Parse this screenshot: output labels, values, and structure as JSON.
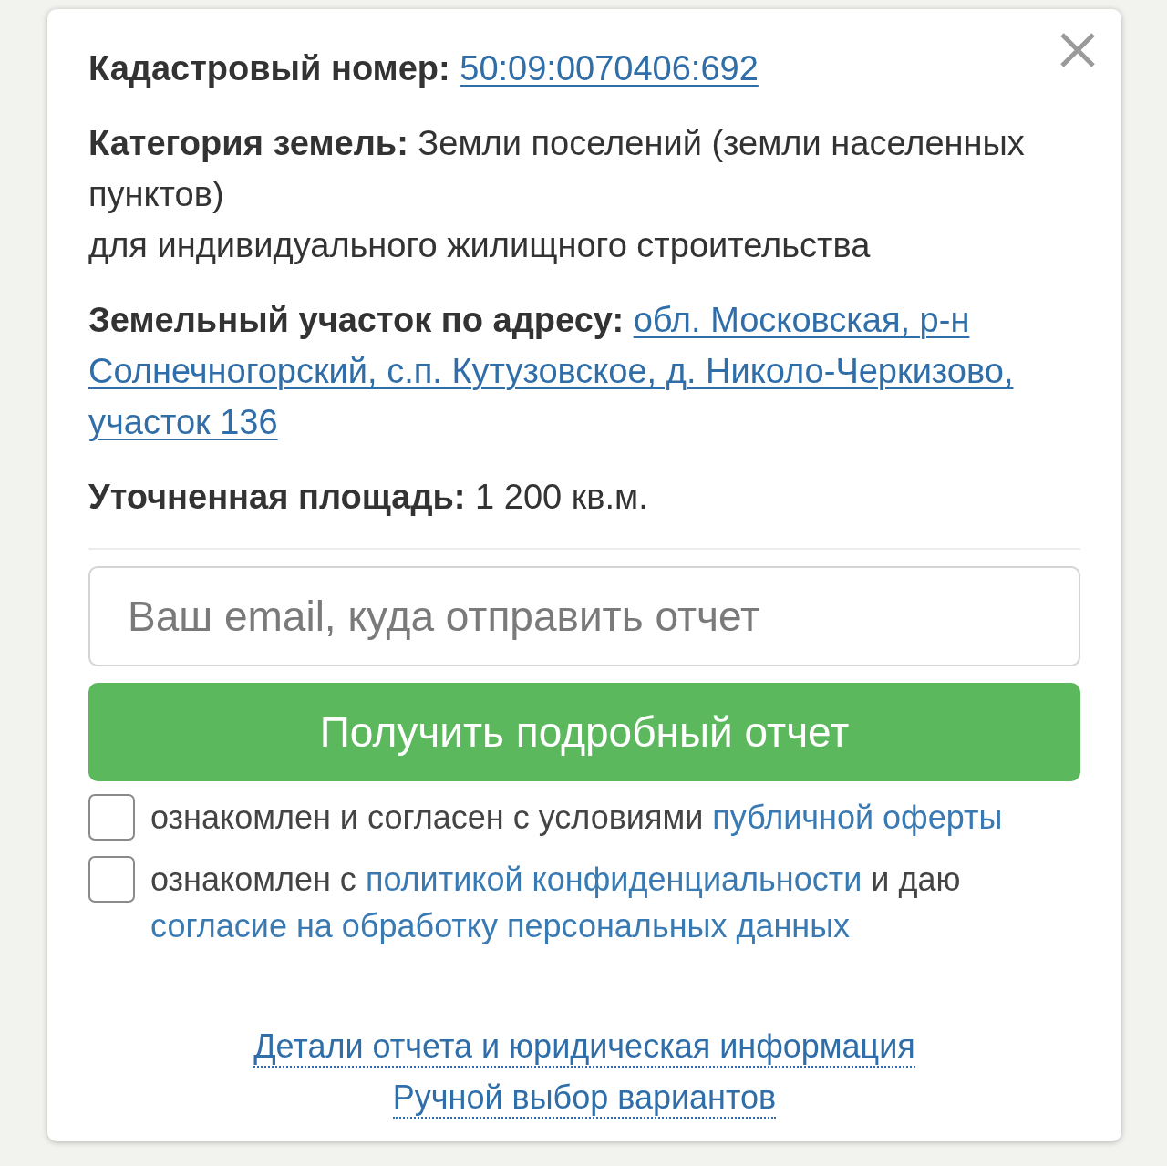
{
  "info": [
    {
      "kind": "link",
      "label": "Кадастровый номер:",
      "value": "50:09:0070406:692"
    },
    {
      "kind": "text",
      "label": "Категория земель:",
      "value": "Земли поселений (земли населенных пунктов)",
      "note": "для индивидуального жилищного строительства"
    },
    {
      "kind": "address",
      "label": "Земельный участок по адресу:",
      "value": "обл. Московская, р-н Солнечногорский, с.п. Кутузовское, д. Николо-Черкизово, участок 136"
    },
    {
      "kind": "text",
      "label": "Уточненная площадь:",
      "value": "1 200 кв.м."
    }
  ],
  "email_field": {
    "placeholder": "Ваш email, куда отправить отчет"
  },
  "submit_button": {
    "label": "Получить подробный отчет"
  },
  "consents": [
    {
      "checked": false,
      "parts": [
        {
          "kind": "text",
          "text": "ознакомлен и согласен с условиями"
        },
        {
          "kind": "link",
          "text": "публичной оферты"
        }
      ]
    },
    {
      "checked": false,
      "parts": [
        {
          "kind": "text",
          "text": "ознакомлен с"
        },
        {
          "kind": "link",
          "text": "политикой конфиденциальности"
        },
        {
          "kind": "text",
          "text": "и даю"
        },
        {
          "kind": "link",
          "text": "согласие на обработку персональных данных"
        }
      ]
    }
  ],
  "footer_links": [
    {
      "label": "Детали отчета и юридическая информация"
    },
    {
      "label": "Ручной выбор вариантов"
    }
  ]
}
